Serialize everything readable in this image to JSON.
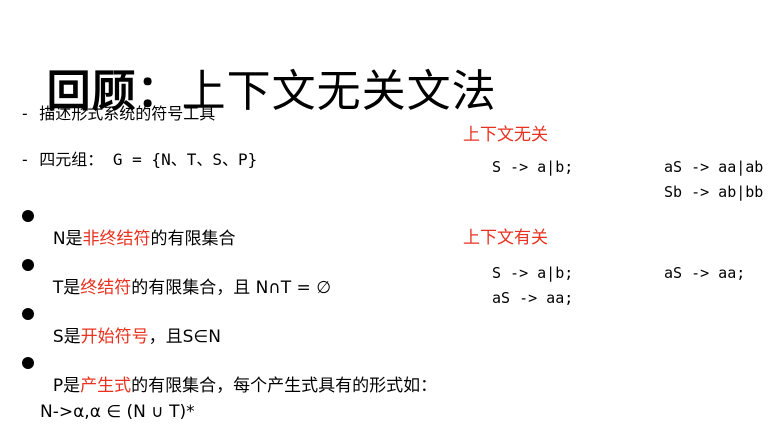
{
  "title": {
    "bold": "回顾：",
    "rest": "上下文无关文法"
  },
  "dash_items": [
    {
      "text": "- 描述形式系统的符号工具"
    },
    {
      "text": "- 四元组： G = {N、T、S、P}"
    }
  ],
  "bullets": [
    {
      "pre": "N是",
      "red": "非终结符",
      "post": "的有限集合"
    },
    {
      "pre": "T是",
      "red": "终结符",
      "post": "的有限集合，且 N∩T = ∅"
    },
    {
      "pre": "S是",
      "red": "开始符号",
      "post": "，且S∈N"
    },
    {
      "pre": "P是",
      "red": "产生式",
      "post": "的有限集合，每个产生式具有的形式如："
    }
  ],
  "production_form": "N->α,α ∈ (N ∪ T)*",
  "context_free": {
    "label": "上下文无关",
    "left": "S -> a|b;",
    "right_1": "aS -> aa|ab",
    "right_2": "Sb -> ab|bb"
  },
  "context_sensitive": {
    "label": "上下文有关",
    "left_1": "S -> a|b;",
    "left_2": "aS -> aa;",
    "right": "aS -> aa;"
  },
  "colors": {
    "accent": "#e8311f",
    "text": "#000000",
    "background": "#ffffff"
  }
}
